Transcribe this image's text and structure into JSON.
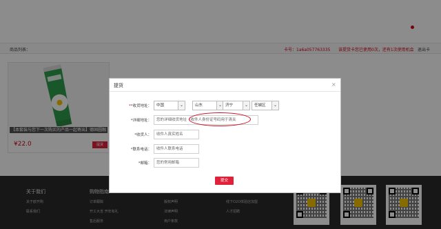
{
  "header": {
    "list_label": "商品列表：",
    "card_no": "卡号：1a6a057763335",
    "card_tip": "该提货卡您已使用0次，还有1次使用机会",
    "logout": "退出卡"
  },
  "product": {
    "name": "【本套装与您下一次购买的产品一起寄出】德国圆融",
    "price": "¥22.0",
    "button": "提货"
  },
  "modal": {
    "title": "提货",
    "close": "×",
    "fields": {
      "address_label": "*收货地址：",
      "country": "中国",
      "province": "山东",
      "city": "济宁",
      "district": "任城区",
      "detail_label": "*详细地址：",
      "detail_placeholder": "您的详细收货地址（收件人身份证号码用于清关",
      "receiver_label": "*收货人：",
      "receiver_placeholder": "收件人真实姓名",
      "phone_label": "*联系电话：",
      "phone_placeholder": "收件人联系电话",
      "email_label": "*邮箱：",
      "email_placeholder": "您的常用邮箱"
    },
    "submit": "提交"
  },
  "footer": {
    "about_title": "关于我们",
    "guide_title": "购物指南",
    "links": [
      "关于欧开购",
      "联系我们",
      "订单跟踪",
      "开工大吉 开年有礼",
      "售后服务",
      "版权声明",
      "法律声明",
      "用户条款",
      "线下O2O体验店加盟",
      "人才招聘"
    ]
  },
  "colors": {
    "accent": "#e0213a",
    "footer_bg": "#2a2a2a"
  }
}
